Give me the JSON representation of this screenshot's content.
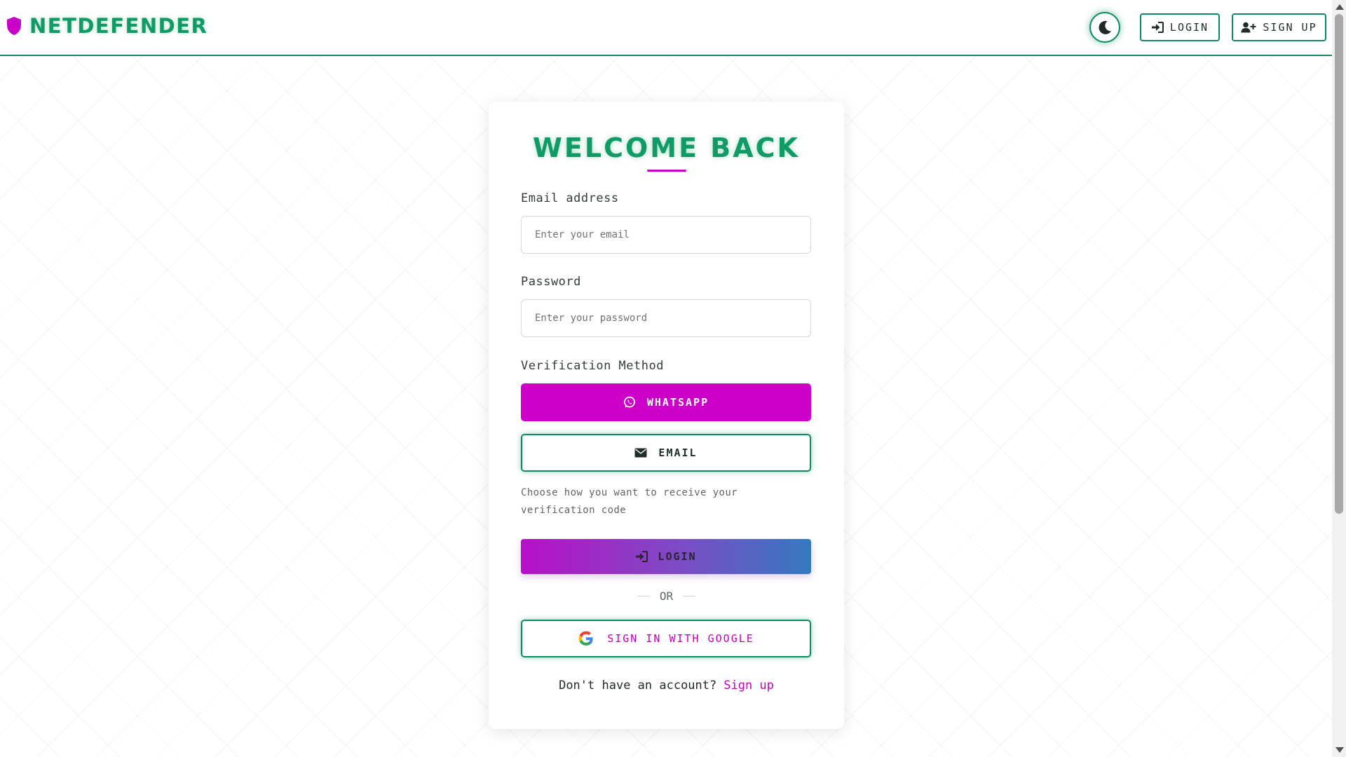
{
  "header": {
    "brand": "NETDEFENDER",
    "login_label": "LOGIN",
    "signup_label": "SIGN UP"
  },
  "form": {
    "title": "WELCOME BACK",
    "email_label": "Email address",
    "email_placeholder": "Enter your email",
    "email_value": "",
    "password_label": "Password",
    "password_placeholder": "Enter your password",
    "password_value": "",
    "verification_label": "Verification Method",
    "whatsapp_label": "WHATSAPP",
    "email_method_label": "EMAIL",
    "helper_text": "Choose how you want to receive your verification code",
    "login_label": "LOGIN",
    "or_label": "OR",
    "google_label": "SIGN IN WITH GOOGLE",
    "no_account_text": "Don't have an account?",
    "signup_link": "Sign up",
    "selected_method": "WHATSAPP"
  },
  "colors": {
    "brand_green": "#0f9a66",
    "accent_magenta": "#cc00c8",
    "gradient_start": "#b80fc8",
    "gradient_end": "#3479c0"
  },
  "icons": [
    "shield-icon",
    "moon-icon",
    "sign-in-icon",
    "user-plus-icon",
    "whatsapp-icon",
    "envelope-icon",
    "google-icon"
  ]
}
